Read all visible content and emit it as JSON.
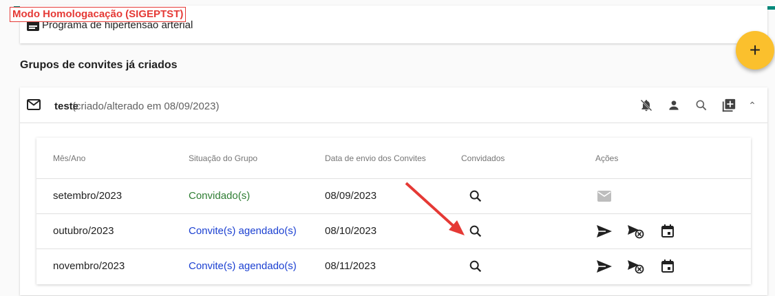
{
  "banner": {
    "text": "Modo Homologacação (SIGEPTST)"
  },
  "program_card": {
    "label": "Programa de hipertensão arterial"
  },
  "fab": {
    "label": "+"
  },
  "section": {
    "title": "Grupos de convites já criados"
  },
  "group": {
    "name": "teste",
    "subtitle": "(criado/alterado em 08/09/2023)",
    "header_icons": [
      "notifications-off-icon",
      "person-icon",
      "search-icon",
      "add-box-icon",
      "chevron-up-icon"
    ]
  },
  "table": {
    "headers": [
      "Mês/Ano",
      "Situação do Grupo",
      "Data de envio dos Convites",
      "Convidados",
      "Ações"
    ],
    "rows": [
      {
        "month": "setembro/2023",
        "status": "Convidado(s)",
        "status_color": "#2e7d32",
        "date": "08/09/2023",
        "actions": [
          "mail-icon"
        ]
      },
      {
        "month": "outubro/2023",
        "status": "Convite(s) agendado(s)",
        "status_color": "#1a3fd1",
        "date": "08/10/2023",
        "actions": [
          "send-icon",
          "cancel-schedule-send-icon",
          "calendar-icon"
        ]
      },
      {
        "month": "novembro/2023",
        "status": "Convite(s) agendado(s)",
        "status_color": "#1a3fd1",
        "date": "08/11/2023",
        "actions": [
          "send-icon",
          "cancel-schedule-send-icon",
          "calendar-icon"
        ]
      }
    ]
  },
  "colors": {
    "accent": "#00897b",
    "fab": "#fbc02d",
    "annotation_arrow": "#e53935"
  }
}
